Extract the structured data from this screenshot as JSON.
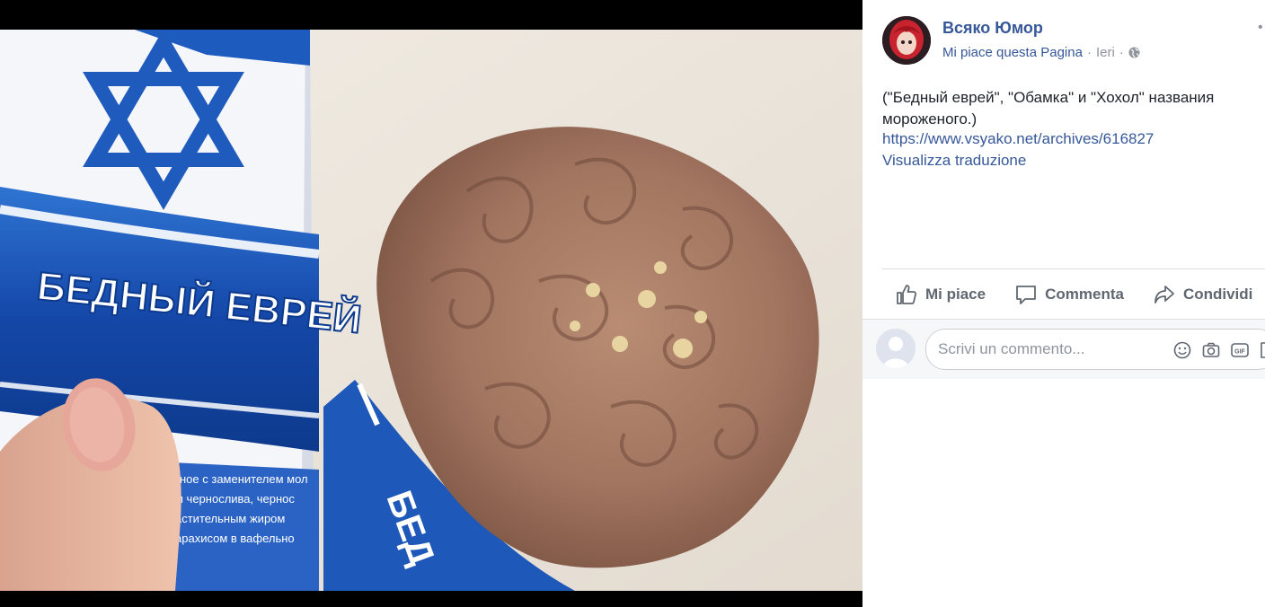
{
  "post": {
    "page_name": "Всяко Юмор",
    "like_page_label": "Mi piace questa Pagina",
    "separator": "·",
    "time": "Ieri",
    "text": "(\"Бедный еврей\", \"Обамка\" и \"Хохол\" названия мороженого.)",
    "link": "https://www.vsyako.net/archives/616827",
    "translate": "Visualizza traduzione"
  },
  "actions": {
    "like": "Mi piace",
    "comment": "Commenta",
    "share": "Condividi"
  },
  "comment": {
    "placeholder": "Scrivi un commento..."
  },
  "photo": {
    "wrapper_title": "БЕДНЫЙ ЕВРЕЙ",
    "wrapper_line_1": "ное с заменителем мол",
    "wrapper_line_2": "м чернослива, чернос",
    "wrapper_line_3": "астительным жиром",
    "wrapper_line_4": "арахисом в вафельно",
    "cone_text": "БЕД"
  },
  "colors": {
    "link_blue": "#365899",
    "wrapper_blue": "#1a56b8",
    "action_gray": "#606770"
  }
}
